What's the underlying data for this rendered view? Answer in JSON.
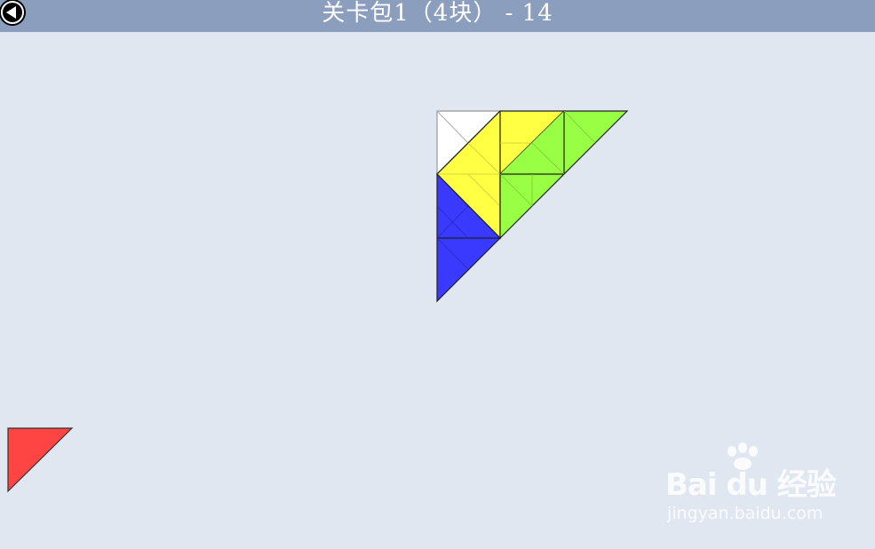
{
  "header": {
    "title": "关卡包1（4块） - 14",
    "back_icon": "back-arrow-icon",
    "bar_color": "#8c9ebd"
  },
  "puzzle": {
    "target_shape": "right-triangle",
    "pieces": [
      {
        "name": "yellow-piece",
        "color": "#ffff44"
      },
      {
        "name": "green-piece",
        "color": "#99ff44"
      },
      {
        "name": "blue-piece",
        "color": "#3a3aff"
      },
      {
        "name": "red-piece",
        "color": "#ff4444"
      }
    ],
    "empty_cell_color": "#ffffff"
  },
  "watermark": {
    "logo": "Bai du 经验",
    "url": "jingyan.baidu.com"
  }
}
